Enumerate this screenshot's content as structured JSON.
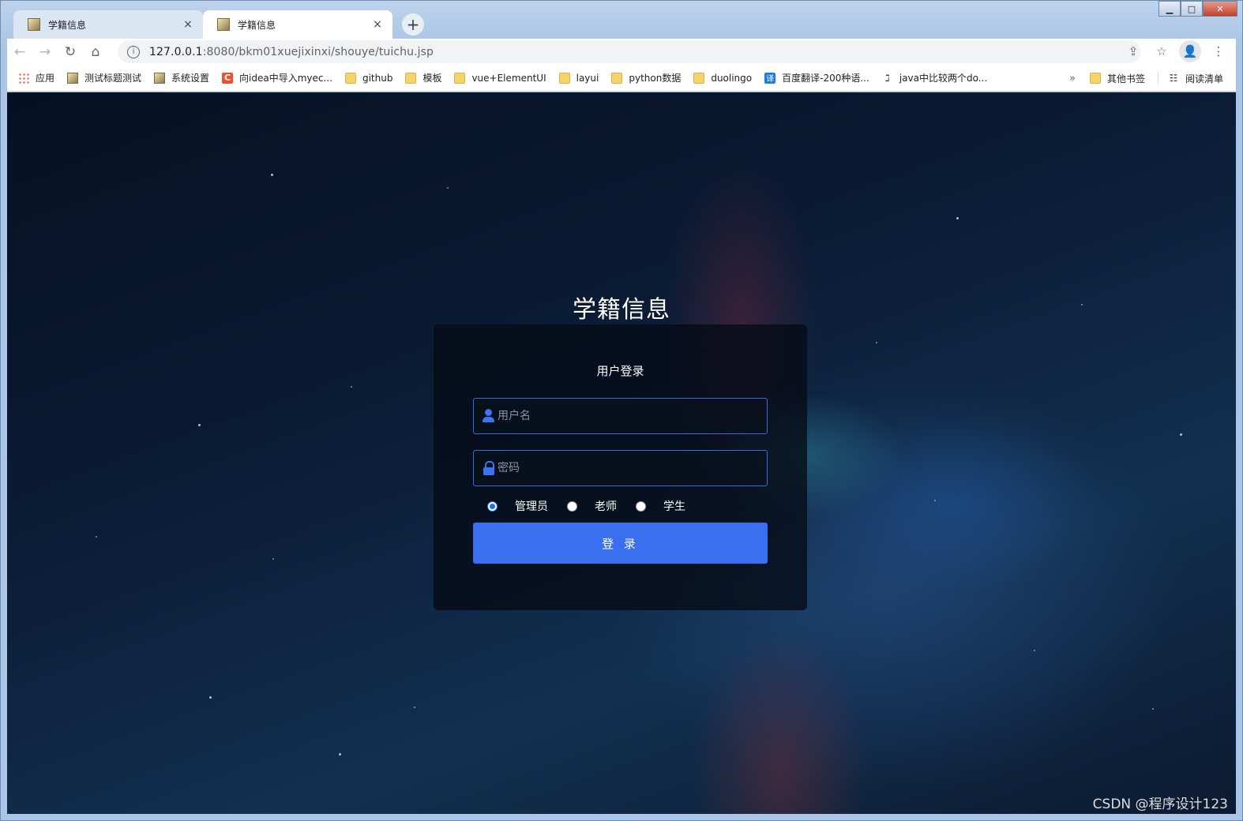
{
  "browser": {
    "tabs": [
      {
        "title": "学籍信息",
        "close": "×"
      },
      {
        "title": "学籍信息",
        "close": "×"
      }
    ],
    "new_tab": "+",
    "window_controls": {
      "minimize": "▁",
      "maximize": "□",
      "close": "✕"
    },
    "nav": {
      "back": "←",
      "forward": "→",
      "reload": "↻",
      "home": "⌂"
    },
    "url_host": "127.0.0.1",
    "url_path": ":8080/bkm01xuejixinxi/shouye/tuichu.jsp",
    "right_tools": {
      "share": "⇪",
      "star": "☆",
      "menu": "⋮"
    },
    "bookmarks": [
      {
        "label": "应用",
        "icon": "apps-icon"
      },
      {
        "label": "测试标题测试",
        "icon": "image-icon"
      },
      {
        "label": "系统设置",
        "icon": "image-icon"
      },
      {
        "label": "向idea中导入myec...",
        "icon": "csdn-icon"
      },
      {
        "label": "github",
        "icon": "folder-icon"
      },
      {
        "label": "模板",
        "icon": "folder-icon"
      },
      {
        "label": "vue+ElementUI",
        "icon": "folder-icon"
      },
      {
        "label": "layui",
        "icon": "folder-icon"
      },
      {
        "label": "python数据",
        "icon": "folder-icon"
      },
      {
        "label": "duolingo",
        "icon": "folder-icon"
      },
      {
        "label": "百度翻译-200种语...",
        "icon": "translate-icon"
      },
      {
        "label": "java中比较两个do...",
        "icon": "java-icon"
      }
    ],
    "csdn_glyph": "C",
    "translate_glyph": "译",
    "java_glyph": "ℷ",
    "more_bookmarks": "»",
    "other_bookmarks": "其他书签",
    "reading_list": "阅读清单",
    "reading_glyph": "☷"
  },
  "page": {
    "title": "学籍信息",
    "card_title": "用户登录",
    "username_placeholder": "用户名",
    "password_placeholder": "密码",
    "roles": [
      {
        "label": "管理员",
        "checked": true
      },
      {
        "label": "老师",
        "checked": false
      },
      {
        "label": "学生",
        "checked": false
      }
    ],
    "login_label": "登 录",
    "watermark": "CSDN @程序设计123"
  },
  "colors": {
    "accent": "#3a70f0",
    "field_border": "#3a6bd8",
    "card_bg": "#050a16"
  }
}
